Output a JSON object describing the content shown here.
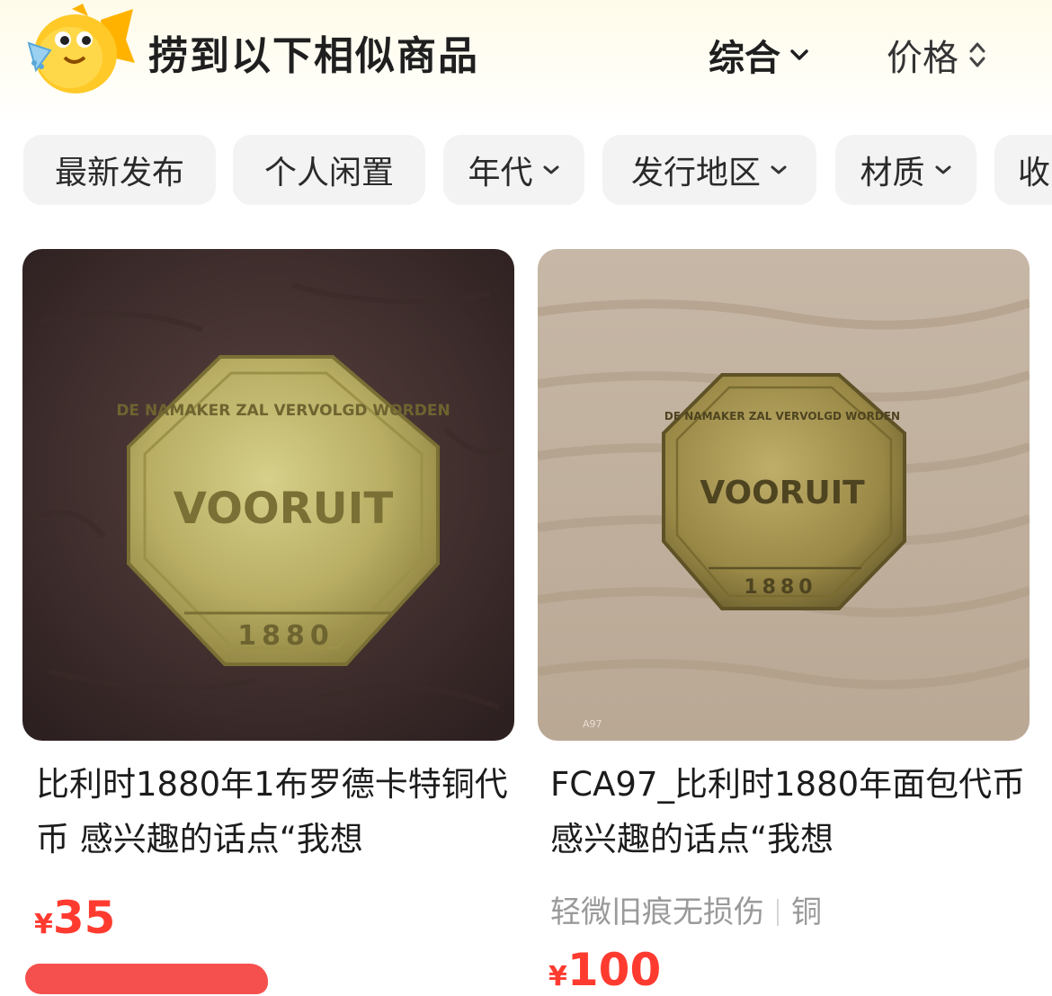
{
  "header": {
    "title": "捞到以下相似商品",
    "sort_comprehensive": "综合",
    "sort_price": "价格"
  },
  "filters": [
    {
      "label": "最新发布",
      "dropdown": false
    },
    {
      "label": "个人闲置",
      "dropdown": false
    },
    {
      "label": "年代",
      "dropdown": true
    },
    {
      "label": "发行地区",
      "dropdown": true
    },
    {
      "label": "材质",
      "dropdown": true
    },
    {
      "label": "收",
      "dropdown": false
    }
  ],
  "products": [
    {
      "title": "比利时1880年1布罗德卡特铜代币 感兴趣的话点“我想",
      "currency": "¥",
      "price": "35",
      "coin_inscription": {
        "top": "DE NAMAKER ZAL VERVOLGD WORDEN",
        "center": "VOORUIT",
        "year": "1880"
      }
    },
    {
      "title": "FCA97_比利时1880年面包代币 感兴趣的话点“我想",
      "tags": [
        "轻微旧痕无损伤",
        "铜"
      ],
      "currency": "¥",
      "price": "100",
      "image_watermark": "A97",
      "coin_inscription": {
        "top": "DE NAMAKER ZAL VERVOLGD WORDEN",
        "center": "VOORUIT",
        "year": "1880"
      }
    }
  ],
  "colors": {
    "price": "#ff3b30",
    "chip_bg": "#f3f3f3",
    "mascot": "#ffc400"
  },
  "icons": [
    "fish-mascot-icon",
    "chevron-down-icon",
    "sort-arrows-icon"
  ]
}
